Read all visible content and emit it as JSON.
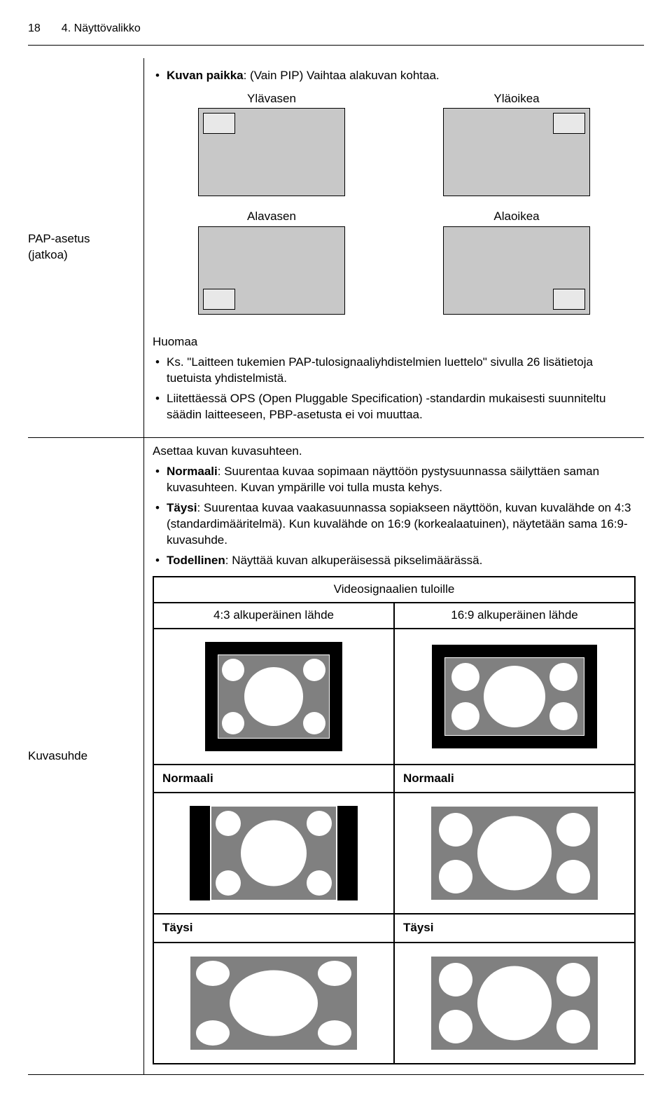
{
  "page_number": "18",
  "section_title": "4. Näyttövalikko",
  "left": {
    "row1_line1": "PAP-asetus",
    "row1_line2": "(jatkoa)",
    "row2": "Kuvasuhde"
  },
  "pip": {
    "intro": "Kuvan paikka",
    "intro_rest": ": (Vain PIP) Vaihtaa alakuvan kohtaa.",
    "pos": {
      "tl": "Ylävasen",
      "tr": "Yläoikea",
      "bl": "Alavasen",
      "br": "Alaoikea"
    },
    "note_head": "Huomaa",
    "note1": "Ks. \"Laitteen tukemien PAP-tulosignaaliyhdistelmien luettelo\" sivulla 26 lisätietoja tuetuista yhdistelmistä.",
    "note2": "Liitettäessä OPS (Open Pluggable Specification) -standardin mukaisesti suunniteltu säädin laitteeseen, PBP-asetusta ei voi muuttaa."
  },
  "aspect": {
    "intro": "Asettaa kuvan kuvasuhteen.",
    "normal_b": "Normaali",
    "normal_rest": ": Suurentaa kuvaa sopimaan näyttöön pystysuunnassa säilyttäen saman kuvasuhteen. Kuvan ympärille voi tulla musta kehys.",
    "full_b": "Täysi",
    "full_rest": ": Suurentaa kuvaa vaakasuunnassa sopiakseen näyttöön, kuvan kuvalähde on 4:3 (standardimääritelmä). Kun kuvalähde on 16:9 (korkealaatuinen), näytetään sama 16:9-kuvasuhde.",
    "real_b": "Todellinen",
    "real_rest": ": Näyttää kuvan alkuperäisessä pikselimäärässä.",
    "table_title": "Videosignaalien tuloille",
    "col_43": "4:3 alkuperäinen lähde",
    "col_169": "16:9 alkuperäinen lähde",
    "label_normal": "Normaali",
    "label_full": "Täysi"
  }
}
